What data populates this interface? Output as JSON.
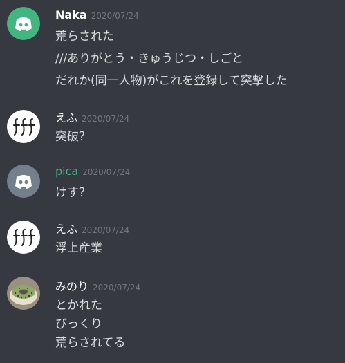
{
  "colors": {
    "background": "#36393f",
    "text": "#dcddde",
    "username_default": "#ffffff",
    "username_pica": "#43b581",
    "timestamp": "#72767d",
    "discord_green": "#43b581",
    "discord_gray": "#747f8d"
  },
  "messages": [
    {
      "author": "Naka",
      "avatar_icon": "discord-logo-green-icon",
      "timestamp": "2020/07/24",
      "lines": [
        "荒らされた",
        "///ありがとう・きゅうじつ・しごと",
        "だれか(同一人物)がこれを登録して突撃した"
      ]
    },
    {
      "author": "えふ",
      "avatar_icon": "fff-logo-icon",
      "timestamp": "2020/07/24",
      "lines": [
        "突破？"
      ]
    },
    {
      "author": "pica",
      "avatar_icon": "discord-logo-gray-icon",
      "timestamp": "2020/07/24",
      "lines": [
        "けす？"
      ]
    },
    {
      "author": "えふ",
      "avatar_icon": "fff-logo-icon",
      "timestamp": "2020/07/24",
      "lines": [
        "浮上産業"
      ]
    },
    {
      "author": "みのり",
      "avatar_icon": "donut-photo-icon",
      "timestamp": "2020/07/24",
      "lines": [
        "とかれた",
        "びっくり",
        "荒らされてる"
      ]
    }
  ]
}
